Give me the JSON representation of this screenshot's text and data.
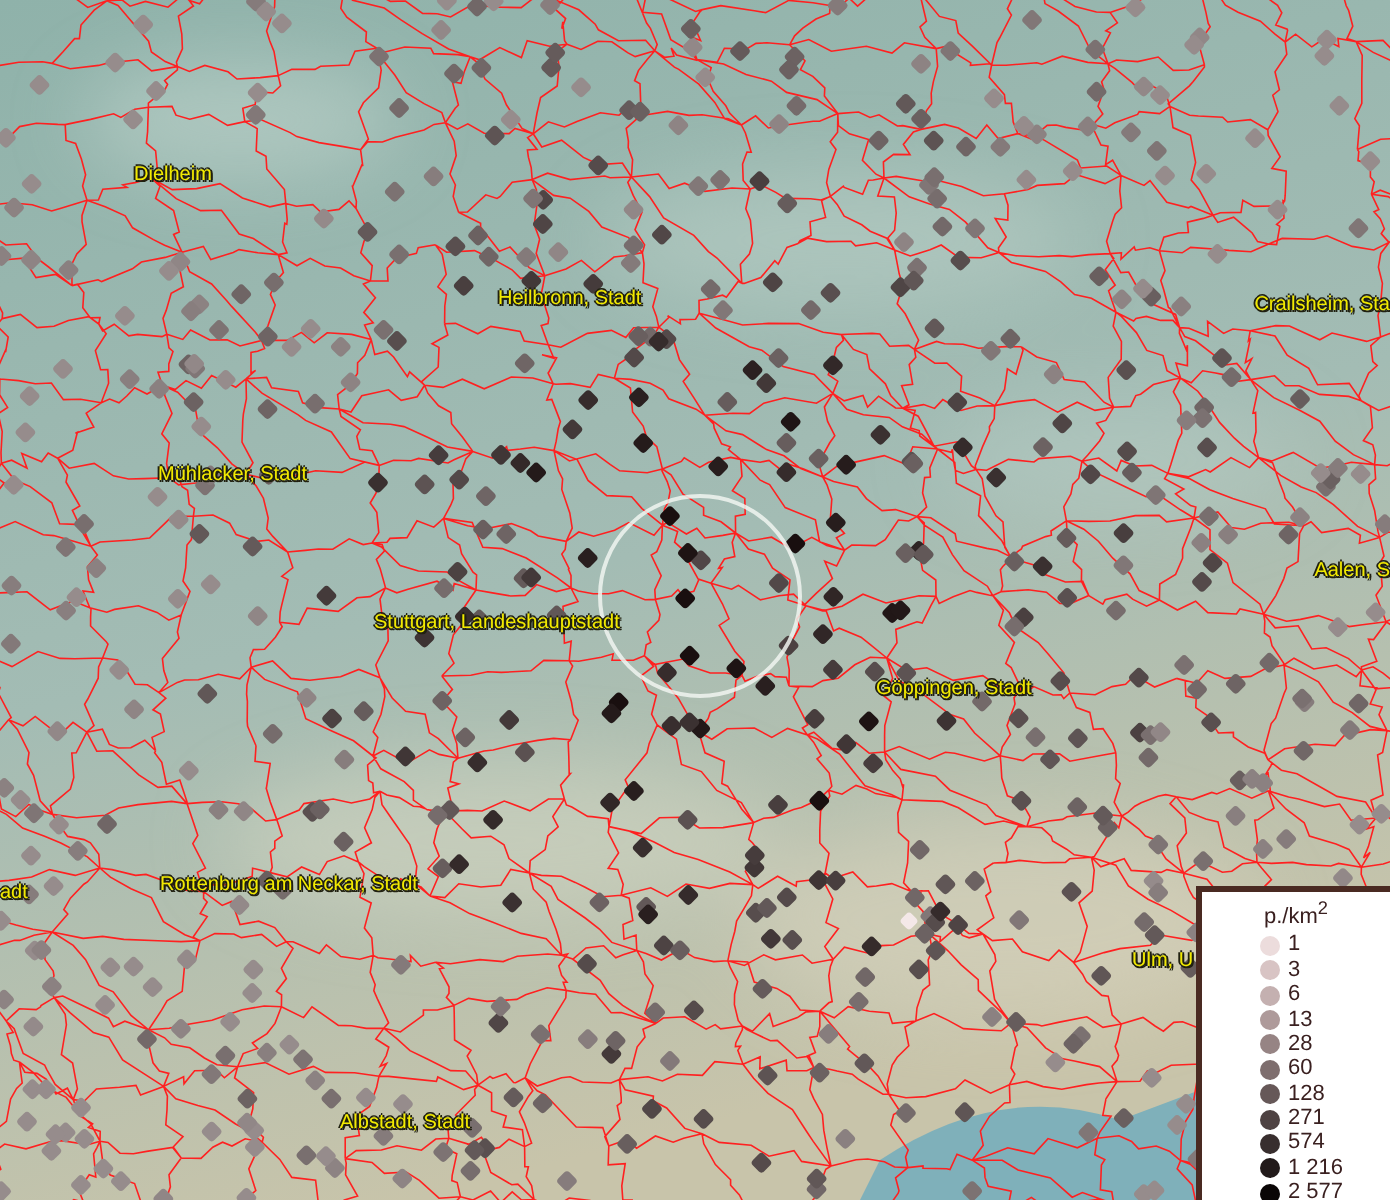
{
  "map": {
    "place_labels": [
      {
        "text": "Dielheim"
      },
      {
        "text": "Heilbronn, Stadt"
      },
      {
        "text": "Crailsheim, Sta"
      },
      {
        "text": "Mühlacker, Stadt"
      },
      {
        "text": "Aalen, S"
      },
      {
        "text": "Stuttgart, Landeshauptstadt"
      },
      {
        "text": "Göppingen, Stadt"
      },
      {
        "text": "adt"
      },
      {
        "text": "Rottenburg am Neckar, Stadt"
      },
      {
        "text": "Ulm, U"
      },
      {
        "text": "Albstadt, Stadt"
      }
    ]
  },
  "legend": {
    "title": "p./km$^{2}$",
    "items": [
      {
        "label": "1",
        "color": "#ecdcdc"
      },
      {
        "label": "3",
        "color": "#d8c4c4"
      },
      {
        "label": "6",
        "color": "#c4b0b0"
      },
      {
        "label": "13",
        "color": "#ae9a9a"
      },
      {
        "label": "28",
        "color": "#968484"
      },
      {
        "label": "60",
        "color": "#7e6e6e"
      },
      {
        "label": "128",
        "color": "#665858"
      },
      {
        "label": "271",
        "color": "#4e4242"
      },
      {
        "label": "574",
        "color": "#382e2e"
      },
      {
        "label": "1 216",
        "color": "#221a1a"
      },
      {
        "label": "2 577",
        "color": "#0a0606"
      }
    ]
  }
}
